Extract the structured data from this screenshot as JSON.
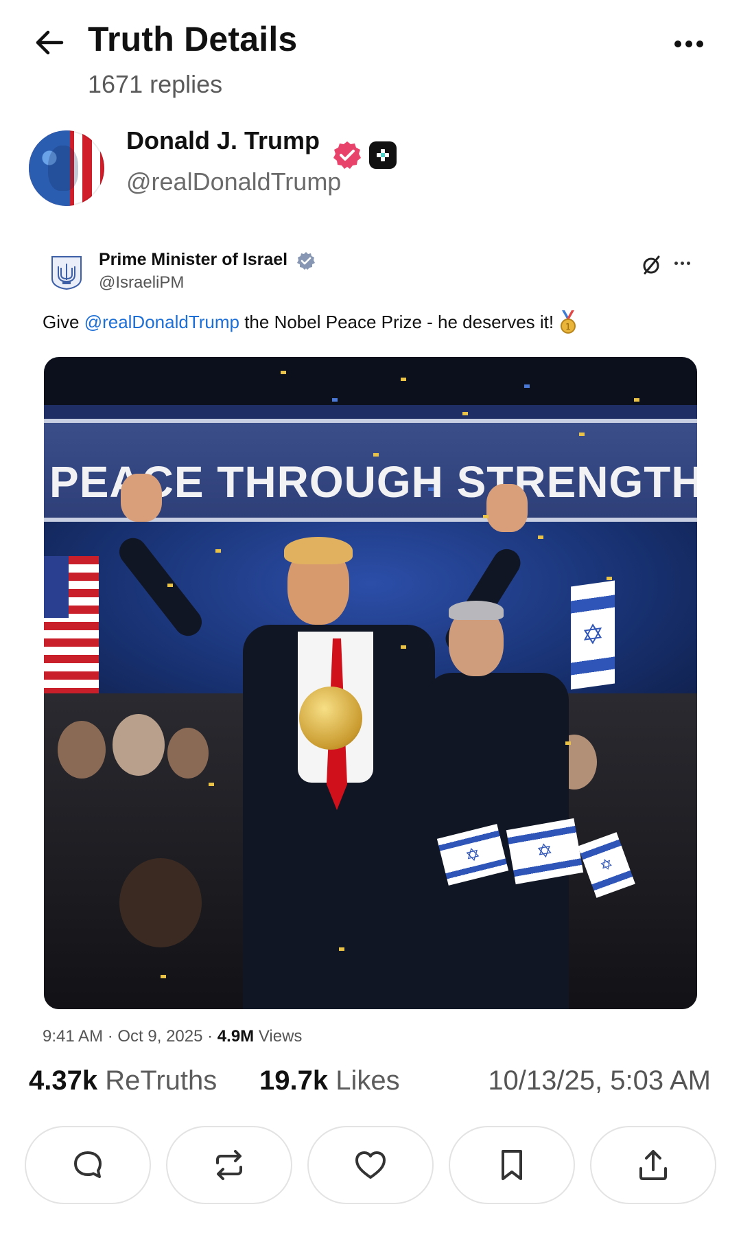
{
  "header": {
    "title": "Truth Details",
    "subtitle": "1671 replies"
  },
  "author": {
    "name": "Donald J. Trump",
    "handle": "@realDonaldTrump"
  },
  "quoted_post": {
    "name": "Prime Minister of Israel",
    "handle": "@IsraeliPM",
    "text_before": "Give ",
    "mention": "@realDonaldTrump",
    "text_after": " the Nobel Peace Prize - he deserves it!",
    "image_banner_text": "PEACE THROUGH STRENGTH"
  },
  "meta": {
    "time": "9:41 AM",
    "date": "Oct 9, 2025",
    "views_count": "4.9M",
    "views_label": "Views",
    "separator": " · "
  },
  "stats": {
    "retruths_count": "4.37k",
    "retruths_label": "ReTruths",
    "likes_count": "19.7k",
    "likes_label": "Likes",
    "timestamp": "10/13/25, 5:03 AM"
  },
  "icons": {
    "back": "arrow-left-icon",
    "more": "more-horizontal-icon",
    "reply": "chat-bubble-icon",
    "retruth": "repost-icon",
    "like": "heart-icon",
    "bookmark": "bookmark-icon",
    "share": "share-upload-icon"
  },
  "colors": {
    "verified_badge": "#e8436b",
    "mention": "#1d6fd6",
    "quote_verified": "#8797b3"
  }
}
